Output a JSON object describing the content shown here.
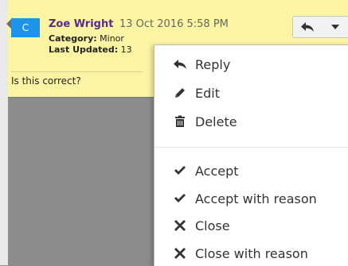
{
  "comment": {
    "badge": "C",
    "author": "Zoe Wright",
    "timestamp": "13 Oct 2016 5:58 PM",
    "category_key": "Category:",
    "category_value": "Minor",
    "updated_key": "Last Updated:",
    "updated_value": "13",
    "text": "Is this correct?"
  },
  "menu": {
    "items": [
      {
        "label": "Reply",
        "icon": "reply-icon"
      },
      {
        "label": "Edit",
        "icon": "pencil-icon"
      },
      {
        "label": "Delete",
        "icon": "trash-icon"
      },
      {
        "label": "Accept",
        "icon": "check-icon"
      },
      {
        "label": "Accept with reason",
        "icon": "check-icon"
      },
      {
        "label": "Close",
        "icon": "close-icon"
      },
      {
        "label": "Close with reason",
        "icon": "close-icon"
      }
    ]
  },
  "colors": {
    "card": "#fbf4a3",
    "badge": "#1f93e8",
    "author": "#5a2a8d"
  }
}
